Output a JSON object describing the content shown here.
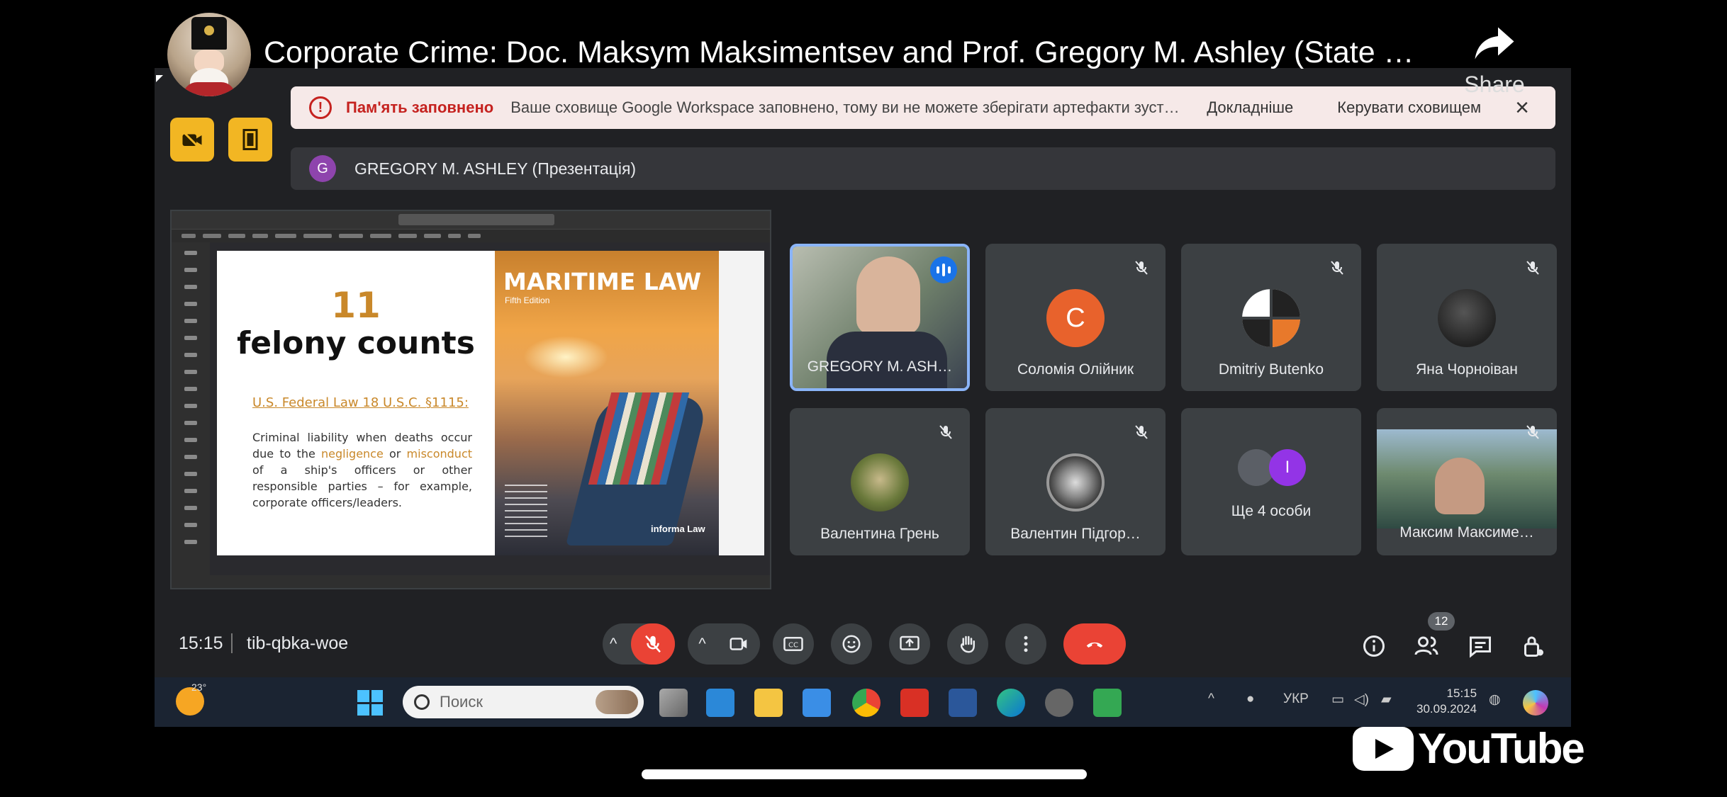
{
  "youtube": {
    "title": "Corporate Crime: Doc. Maksym Maksimentsev and Prof. Gregory M. Ashley (State …",
    "share_label": "Share",
    "logo_text": "YouTube"
  },
  "meet": {
    "banner": {
      "title": "Пам'ять заповнено",
      "message": "Ваше сховище Google Workspace заповнено, тому ви не можете зберігати артефакти зуст…",
      "more_link": "Докладніше",
      "manage_link": "Керувати сховищем",
      "close_icon": "×"
    },
    "presenter": {
      "initial": "G",
      "label": "GREGORY M. ASHLEY (Презентація)"
    },
    "slide": {
      "count": "11",
      "count_text": "felony counts",
      "law": "U.S. Federal Law 18 U.S.C. §1115:",
      "desc_1": "Criminal liability when deaths occur due to the ",
      "desc_hl1": "negligence",
      "desc_2": " or ",
      "desc_hl2": "misconduct",
      "desc_3": " of a ship's officers or other responsible parties – for example, corporate officers/leaders.",
      "book_title": "MARITIME LAW",
      "book_edition": "Fifth Edition",
      "book_publisher": "informa Law"
    },
    "participants": [
      {
        "name": "GREGORY M. ASH…",
        "type": "video",
        "speaking": true
      },
      {
        "name": "Соломія Олійник",
        "initial": "C",
        "color": "#e8622c",
        "muted": true
      },
      {
        "name": "Dmitriy Butenko",
        "muted": true
      },
      {
        "name": "Яна Чорноіван",
        "muted": true
      },
      {
        "name": "Валентина Грень",
        "muted": true
      },
      {
        "name": "Валентин Підгор…",
        "muted": true
      },
      {
        "name": "Ще 4 особи",
        "initial": "I",
        "color": "#9334e6"
      },
      {
        "name": "Максим Максиме…",
        "type": "video",
        "muted": true
      }
    ],
    "bar": {
      "time": "15:15",
      "meeting_code": "tib-qbka-woe",
      "people_count": "12"
    }
  },
  "taskbar": {
    "temperature": "23°",
    "search_placeholder": "Поиск",
    "language": "УКР",
    "clock_time": "15:15",
    "clock_date": "30.09.2024"
  },
  "colors": {
    "meet_bg": "#202124",
    "tile_bg": "#3c4043",
    "end_call": "#ea4335",
    "accent_blue": "#8ab4f8",
    "warning_red": "#c5221f",
    "side_button": "#f2b623"
  }
}
